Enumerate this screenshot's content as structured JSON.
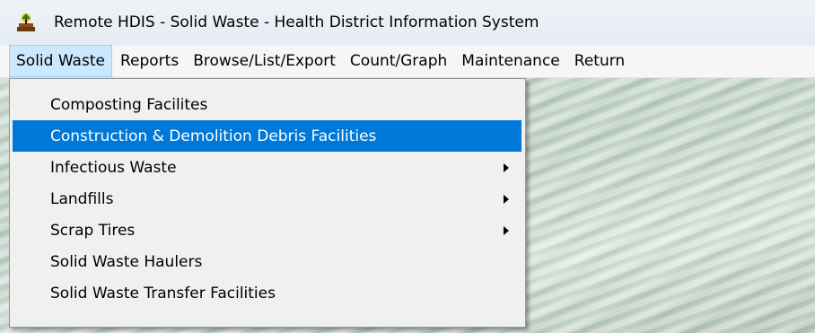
{
  "window": {
    "title": "Remote HDIS - Solid Waste - Health District Information System",
    "icon": "hdis-app-icon"
  },
  "menubar": {
    "items": [
      {
        "label": "Solid Waste"
      },
      {
        "label": "Reports"
      },
      {
        "label": "Browse/List/Export"
      },
      {
        "label": "Count/Graph"
      },
      {
        "label": "Maintenance"
      },
      {
        "label": "Return"
      }
    ]
  },
  "dropdown": {
    "items": [
      {
        "label": "Composting Facilites",
        "submenu": false
      },
      {
        "label": "Construction & Demolition Debris Facilities",
        "submenu": false,
        "highlighted": true
      },
      {
        "label": "Infectious Waste",
        "submenu": true
      },
      {
        "label": "Landfills",
        "submenu": true
      },
      {
        "label": "Scrap Tires",
        "submenu": true
      },
      {
        "label": "Solid Waste Haulers",
        "submenu": false
      },
      {
        "label": "Solid Waste Transfer Facilities",
        "submenu": false
      }
    ]
  },
  "colors": {
    "highlight": "#0078d7",
    "menu_open": "#cce8ff",
    "menu_open_border": "#99d1ff"
  }
}
